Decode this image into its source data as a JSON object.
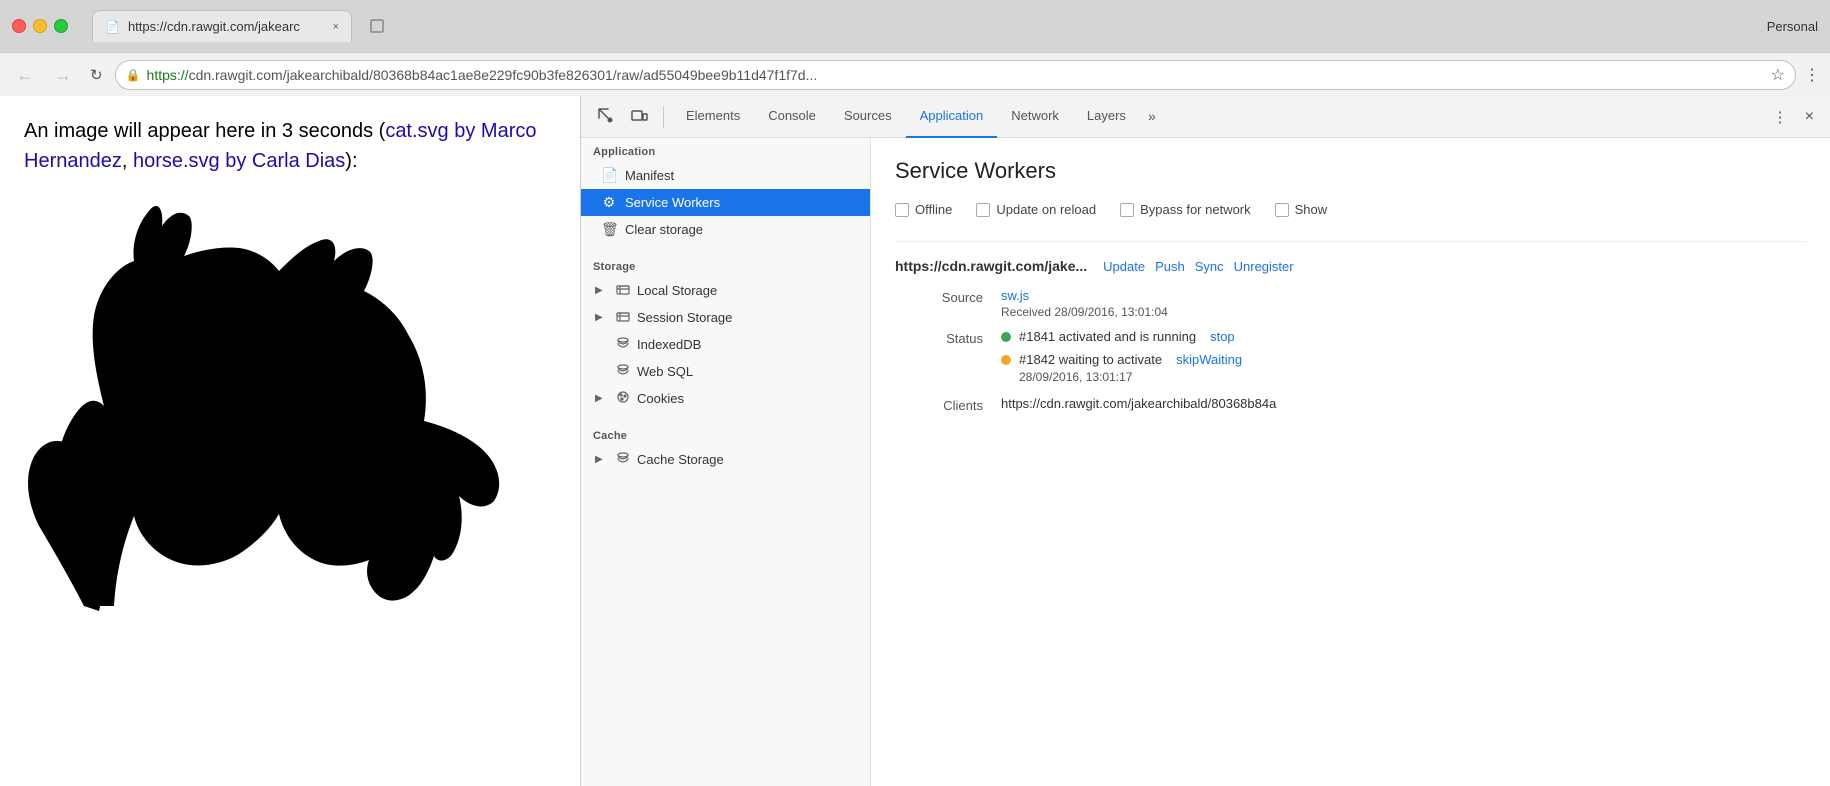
{
  "browser": {
    "profile": "Personal",
    "tab": {
      "icon": "📄",
      "title": "https://cdn.rawgit.com/jakearc",
      "close_label": "×"
    },
    "new_tab_label": "□",
    "nav": {
      "back_label": "←",
      "forward_label": "→",
      "refresh_label": "↻"
    },
    "address": {
      "protocol": "https://",
      "full": "https://cdn.rawgit.com/jakearchibald/80368b84ac1ae8e229fc90b3fe826301/raw/ad55049bee9b11d47f1f7d...",
      "display_secure": "https://cdn.rawgit.com/jakearchibald/80368b84ac1ae8e229fc90b3fe826301/raw/ad55049bee9b11d47f1f7d...",
      "lock_icon": "🔒"
    },
    "star_icon": "☆",
    "more_vert": "⋮"
  },
  "page": {
    "text_prefix": "An image will appear here in 3 seconds (",
    "link1_text": "cat.svg by Marco Hernandez",
    "link1_href": "#",
    "separator": ", ",
    "link2_text": "horse.svg by Carla Dias",
    "link2_href": "#",
    "text_suffix": "):"
  },
  "devtools": {
    "cursor_icon": "↖",
    "responsive_icon": "⬜",
    "tabs": [
      {
        "id": "elements",
        "label": "Elements",
        "active": false
      },
      {
        "id": "console",
        "label": "Console",
        "active": false
      },
      {
        "id": "sources",
        "label": "Sources",
        "active": false
      },
      {
        "id": "application",
        "label": "Application",
        "active": true
      },
      {
        "id": "network",
        "label": "Network",
        "active": false
      },
      {
        "id": "layers",
        "label": "Layers",
        "active": false
      }
    ],
    "more_tabs_label": "»",
    "options_icon": "⋮",
    "close_label": "×",
    "sidebar": {
      "application_section": "Application",
      "application_items": [
        {
          "id": "manifest",
          "icon": "📄",
          "label": "Manifest"
        },
        {
          "id": "service-workers",
          "icon": "⚙",
          "label": "Service Workers",
          "selected": true
        },
        {
          "id": "clear-storage",
          "icon": "🗑",
          "label": "Clear storage"
        }
      ],
      "storage_section": "Storage",
      "storage_tree_items": [
        {
          "id": "local-storage",
          "icon": "⊞",
          "label": "Local Storage",
          "has_arrow": true
        },
        {
          "id": "session-storage",
          "icon": "⊞",
          "label": "Session Storage",
          "has_arrow": true
        },
        {
          "id": "indexeddb",
          "icon": "🗄",
          "label": "IndexedDB",
          "has_arrow": false
        },
        {
          "id": "websql",
          "icon": "🗄",
          "label": "Web SQL",
          "has_arrow": false
        },
        {
          "id": "cookies",
          "icon": "🍪",
          "label": "Cookies",
          "has_arrow": true
        }
      ],
      "cache_section": "Cache",
      "cache_tree_items": [
        {
          "id": "cache-storage",
          "icon": "🗄",
          "label": "Cache Storage",
          "has_arrow": true
        }
      ]
    },
    "main": {
      "title": "Service Workers",
      "checkboxes": [
        {
          "id": "offline",
          "label": "Offline",
          "checked": false
        },
        {
          "id": "update-on-reload",
          "label": "Update on reload",
          "checked": false
        },
        {
          "id": "bypass-for-network",
          "label": "Bypass for network",
          "checked": false
        },
        {
          "id": "show",
          "label": "Show",
          "checked": false
        }
      ],
      "sw_entry": {
        "url": "https://cdn.rawgit.com/jake...",
        "actions": [
          {
            "id": "update",
            "label": "Update"
          },
          {
            "id": "push",
            "label": "Push"
          },
          {
            "id": "sync",
            "label": "Sync"
          },
          {
            "id": "unregister",
            "label": "Unregister"
          }
        ],
        "source_label": "Source",
        "source_file": "sw.js",
        "source_timestamp": "Received 28/09/2016, 13:01:04",
        "status_label": "Status",
        "status_entries": [
          {
            "dot_color": "green",
            "text": "#1841 activated and is running",
            "action_label": "stop",
            "action_id": "stop"
          },
          {
            "dot_color": "orange",
            "text": "#1842 waiting to activate",
            "action_label": "skipWaiting",
            "action_id": "skipWaiting",
            "timestamp": "28/09/2016, 13:01:17"
          }
        ],
        "clients_label": "Clients",
        "clients_value": "https://cdn.rawgit.com/jakearchibald/80368b84a"
      }
    }
  }
}
